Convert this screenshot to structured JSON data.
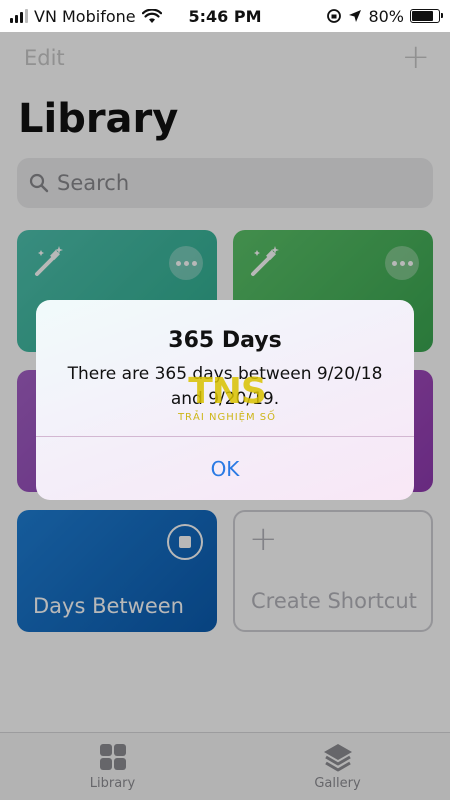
{
  "status_bar": {
    "carrier": "VN Mobifone",
    "time": "5:46 PM",
    "battery_percent": "80%",
    "battery_level": 0.8
  },
  "nav": {
    "edit_label": "Edit",
    "add_icon": "plus-icon"
  },
  "page": {
    "title": "Library"
  },
  "search": {
    "placeholder": "Search",
    "icon": "search-icon"
  },
  "shortcuts": [
    {
      "color": "#3cb8a0",
      "icon": "magic-wand-icon"
    },
    {
      "color": "#4cb55e",
      "icon": "magic-wand-icon"
    },
    {
      "color": "#9a4dbf"
    },
    {
      "color": "#a04bbf"
    },
    {
      "label": "Days Between",
      "color": "#1570c8",
      "icon": "stop-icon"
    }
  ],
  "create_shortcut": {
    "label": "Create Shortcut",
    "icon": "plus-icon"
  },
  "tabs": [
    {
      "label": "Library",
      "icon": "grid-icon"
    },
    {
      "label": "Gallery",
      "icon": "layers-icon"
    }
  ],
  "alert": {
    "title": "365 Days",
    "message": "There are 365 days between 9/20/18 and 9/20/19.",
    "ok_label": "OK"
  },
  "watermark": {
    "logo": "TNS",
    "tagline": "TRẢI NGHIỆM SỐ"
  }
}
